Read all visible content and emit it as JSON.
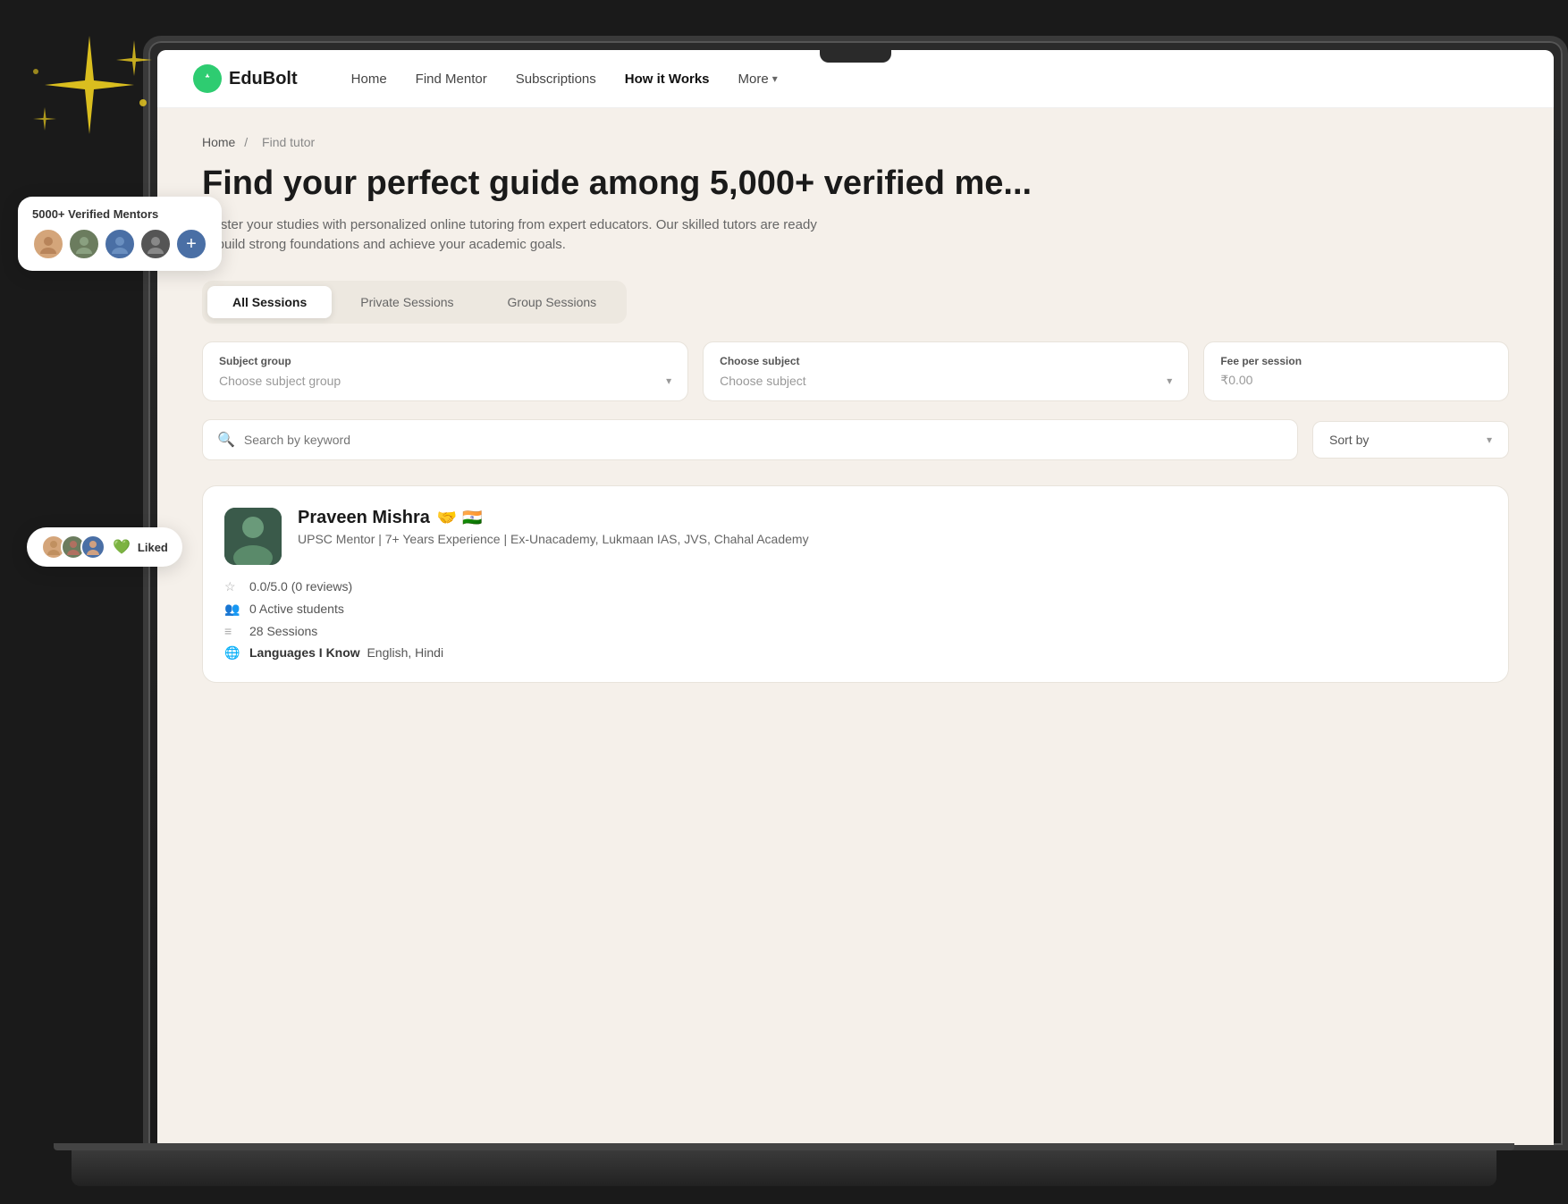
{
  "background": "#1a1a1a",
  "sparkles": {
    "color": "#f0d020"
  },
  "verified_badge": {
    "title": "5000+ Verified Mentors",
    "avatars": [
      "👤",
      "👤",
      "👤",
      "👤"
    ],
    "plus_label": "+"
  },
  "liked_badge": {
    "text": "Liked",
    "heart": "💚"
  },
  "navbar": {
    "logo_text": "EduBolt",
    "logo_icon": "⚡",
    "links": [
      {
        "label": "Home",
        "active": false
      },
      {
        "label": "Find Mentor",
        "active": false
      },
      {
        "label": "Subscriptions",
        "active": false
      },
      {
        "label": "How it Works",
        "active": true
      },
      {
        "label": "More",
        "active": false,
        "has_dropdown": true
      }
    ]
  },
  "breadcrumb": {
    "home": "Home",
    "separator": "/",
    "current": "Find tutor"
  },
  "hero": {
    "title": "Find your perfect guide among 5,000+ verified me...",
    "subtitle": "Master your studies with personalized online tutoring from expert educators. Our skilled tutors are ready to build strong foundations and achieve your academic goals."
  },
  "tabs": [
    {
      "label": "All Sessions",
      "active": true
    },
    {
      "label": "Private Sessions",
      "active": false
    },
    {
      "label": "Group Sessions",
      "active": false
    }
  ],
  "filters": [
    {
      "label": "Subject group",
      "placeholder": "Choose subject group",
      "id": "subject-group"
    },
    {
      "label": "Choose subject",
      "placeholder": "Choose subject",
      "id": "subject"
    },
    {
      "label": "Fee per session",
      "placeholder": "₹0.00",
      "id": "fee"
    }
  ],
  "search": {
    "placeholder": "Search by keyword"
  },
  "sort": {
    "label": "Sort by",
    "placeholder": "Sort by"
  },
  "tutor": {
    "name": "Praveen Mishra",
    "description": "UPSC Mentor | 7+ Years Experience | Ex-Unacademy, Lukmaan IAS, JVS, Chahal Academy",
    "rating": "0.0/5.0 (0 reviews)",
    "active_students": "0 Active students",
    "sessions": "28 Sessions",
    "languages_label": "Languages I Know",
    "languages": "English, Hindi"
  }
}
